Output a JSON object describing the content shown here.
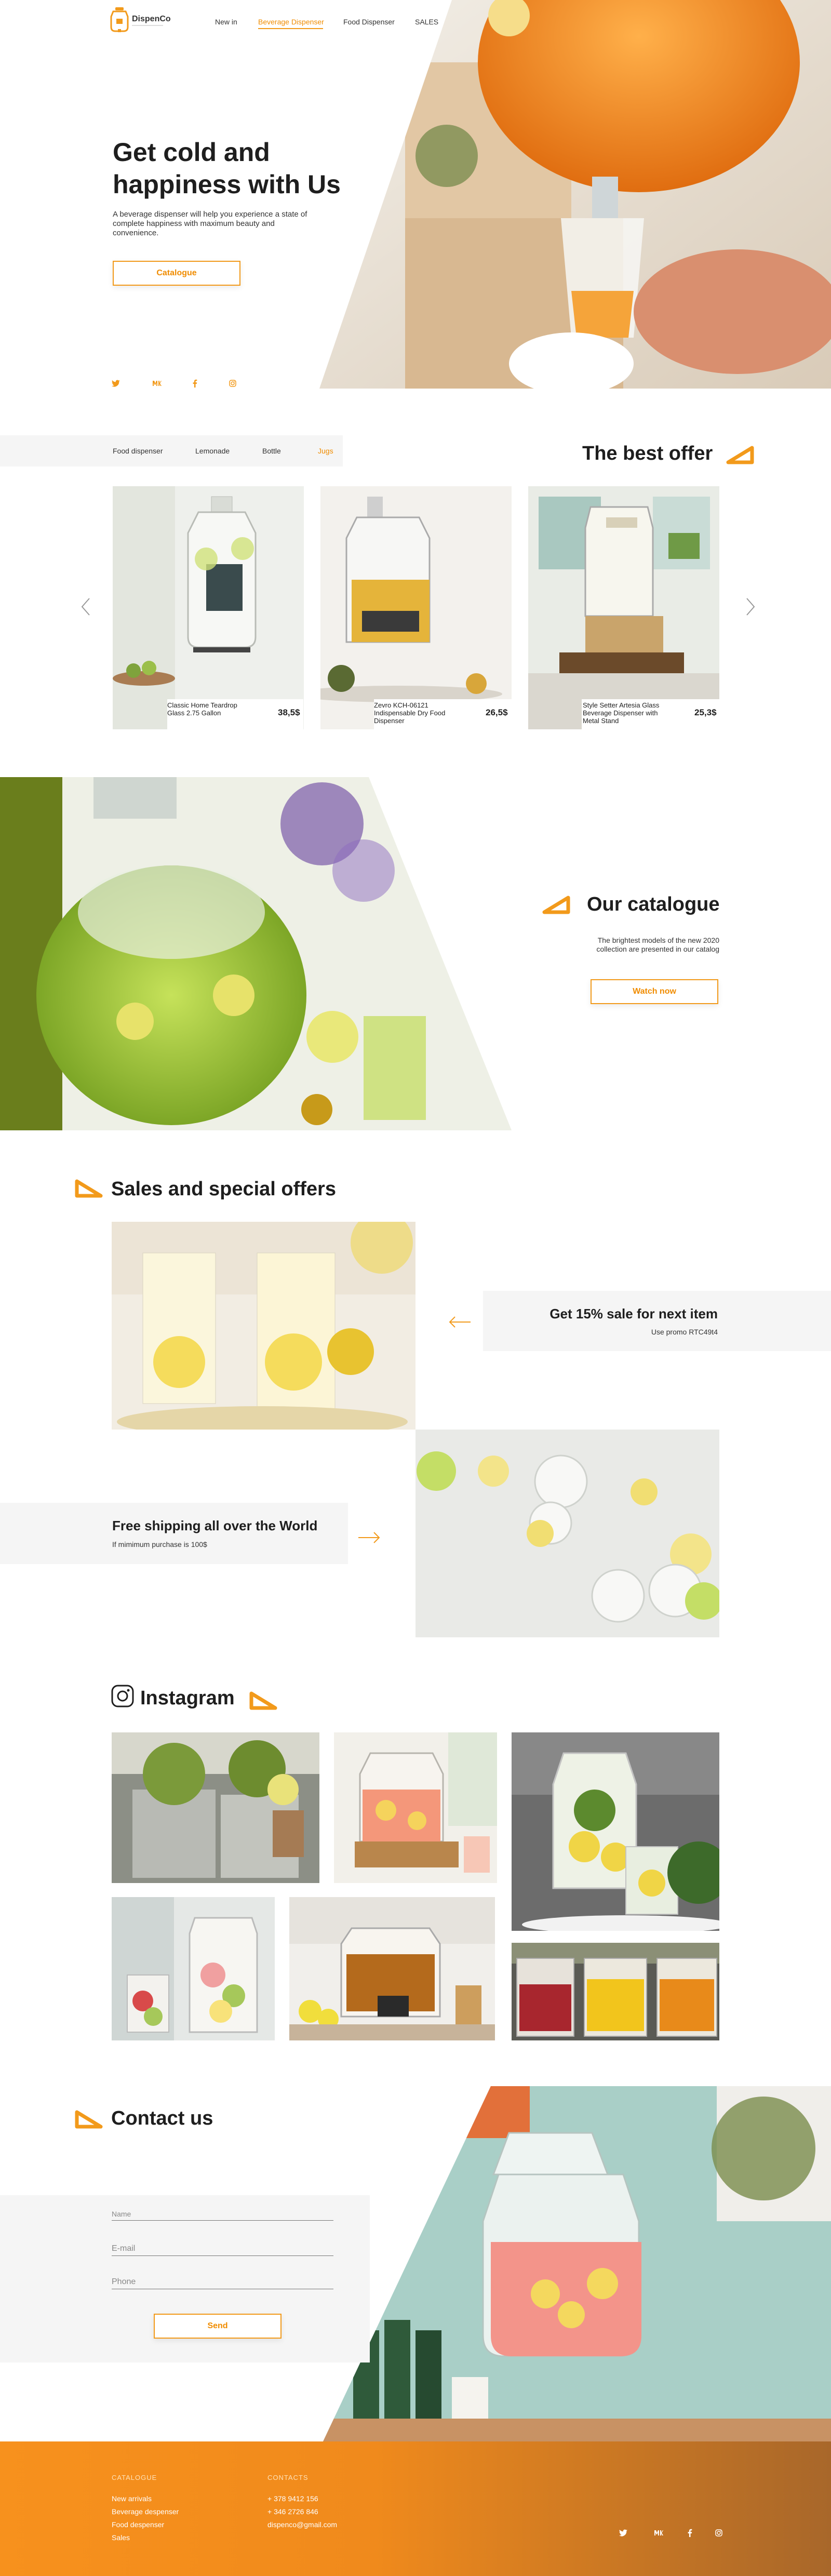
{
  "header": {
    "logo_text": "DispenCo",
    "nav": [
      "New in",
      "Beverage Dispenser",
      "Food Dispenser",
      "SALES"
    ],
    "active_nav": "Beverage Dispenser"
  },
  "hero": {
    "title": "Get cold and happiness with Us",
    "subtitle": "A beverage dispenser will help you experience a state of complete happiness with maximum beauty and convenience.",
    "button": "Catalogue",
    "socials": [
      "twitter-icon",
      "vk-icon",
      "facebook-icon",
      "instagram-icon"
    ]
  },
  "best_offer": {
    "tabs": [
      "Food dispenser",
      "Lemonade",
      "Bottle",
      "Jugs"
    ],
    "active_tab": "Jugs",
    "title": "The best offer",
    "products": [
      {
        "name": "Classic Home Teardrop Glass 2.75 Gallon",
        "price": "38,5$"
      },
      {
        "name": "Zevro KCH-06121 Indispensable Dry Food Dispenser",
        "price": "26,5$"
      },
      {
        "name": "Style Setter Artesia Glass Beverage Dispenser with Metal Stand",
        "price": "25,3$"
      }
    ]
  },
  "catalogue": {
    "title": "Our catalogue",
    "text": "The brightest models of the new 2020 collection are presented in our catalog",
    "button": "Watch now"
  },
  "sales": {
    "title": "Sales and special offers",
    "offer1_title": "Get 15% sale for next item",
    "offer1_text": "Use promo RTC49t4",
    "offer2_title": "Free shipping all over the World",
    "offer2_text": "If mimimum purchase is 100$"
  },
  "instagram": {
    "title": "Instagram"
  },
  "contact": {
    "title": "Contact us",
    "name_placeholder": "Name",
    "email_placeholder": "E-mail",
    "phone_placeholder": "Phone",
    "button": "Send"
  },
  "footer": {
    "catalogue_heading": "CATALOGUE",
    "catalogue_links": [
      "New arrivals",
      "Beverage despenser",
      "Food despenser",
      "Sales"
    ],
    "contacts_heading": "CONTACTS",
    "contacts": [
      "+ 378 9412 156",
      "+ 346 2726 846",
      "dispenco@gmail.com"
    ]
  },
  "colors": {
    "accent": "#f08c00",
    "footer_gradient_start": "#f7911d",
    "footer_gradient_end": "#a8672a",
    "light_panel": "#f5f5f5"
  }
}
